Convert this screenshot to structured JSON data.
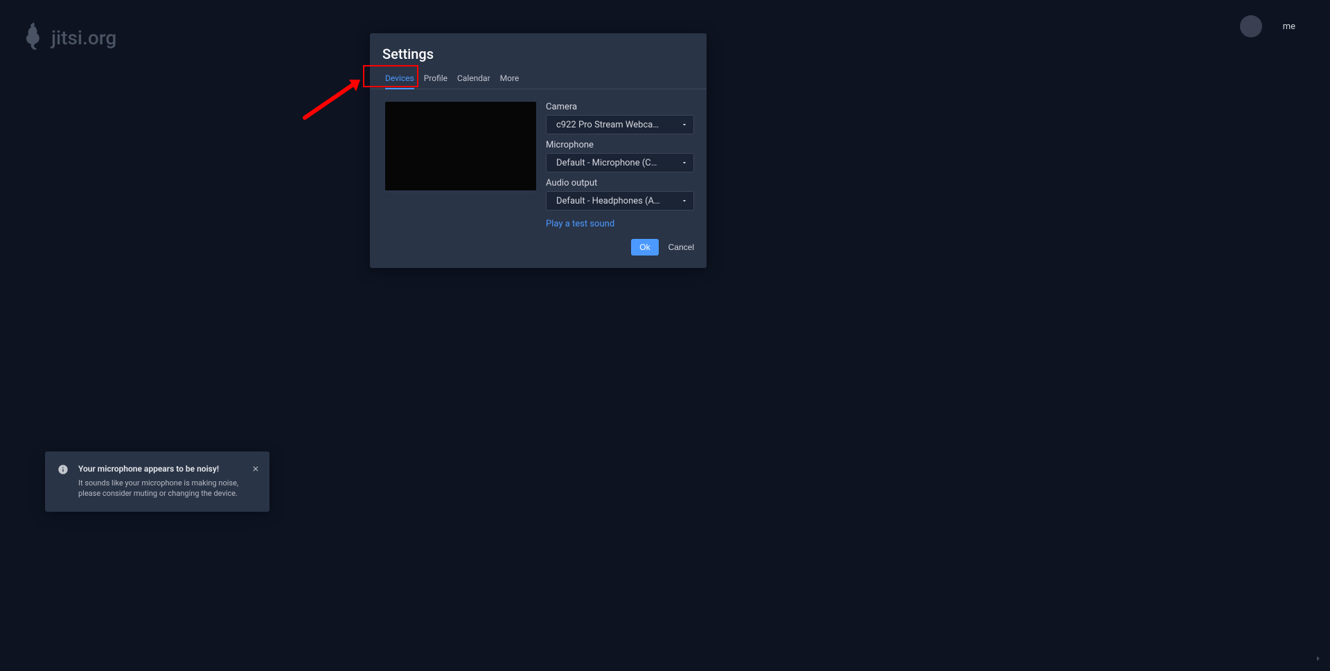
{
  "logo": {
    "text": "jitsi.org"
  },
  "user": {
    "me_label": "me"
  },
  "dialog": {
    "title": "Settings",
    "tabs": [
      {
        "label": "Devices",
        "active": true
      },
      {
        "label": "Profile",
        "active": false
      },
      {
        "label": "Calendar",
        "active": false
      },
      {
        "label": "More",
        "active": false
      }
    ],
    "camera": {
      "label": "Camera",
      "value": "c922 Pro Stream Webcam …"
    },
    "microphone": {
      "label": "Microphone",
      "value": "Default - Microphone (C92…"
    },
    "audio_out": {
      "label": "Audio output",
      "value": "Default - Headphones (Arct…"
    },
    "test_sound": "Play a test sound",
    "ok": "Ok",
    "cancel": "Cancel"
  },
  "toast": {
    "title": "Your microphone appears to be noisy!",
    "body": "It sounds like your microphone is making noise, please consider muting or changing the device."
  }
}
